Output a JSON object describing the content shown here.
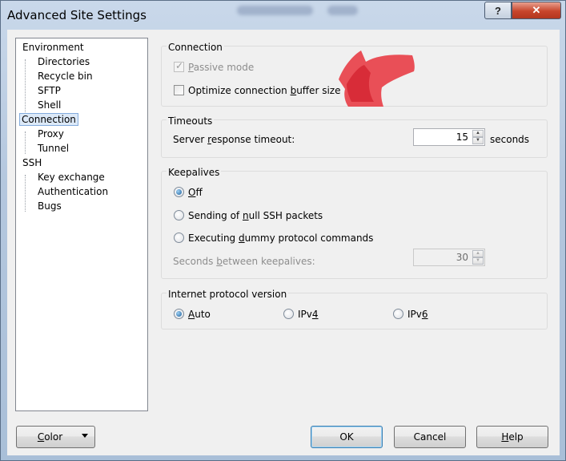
{
  "window": {
    "title": "Advanced Site Settings"
  },
  "tree": {
    "items": [
      {
        "label": "Environment",
        "level": 0
      },
      {
        "label": "Directories",
        "level": 1
      },
      {
        "label": "Recycle bin",
        "level": 1
      },
      {
        "label": "SFTP",
        "level": 1
      },
      {
        "label": "Shell",
        "level": 1
      },
      {
        "label": "Connection",
        "level": 0,
        "selected": true
      },
      {
        "label": "Proxy",
        "level": 1
      },
      {
        "label": "Tunnel",
        "level": 1
      },
      {
        "label": "SSH",
        "level": 0
      },
      {
        "label": "Key exchange",
        "level": 1
      },
      {
        "label": "Authentication",
        "level": 1
      },
      {
        "label": "Bugs",
        "level": 1
      }
    ]
  },
  "connection": {
    "title": "Connection",
    "passive_mode": {
      "label_pre": "",
      "label_u": "P",
      "label_post": "assive mode",
      "checked": true,
      "enabled": false
    },
    "optimize_buffer": {
      "label_pre": "Optimize connection ",
      "label_u": "b",
      "label_post": "uffer size",
      "checked": false
    }
  },
  "timeouts": {
    "title": "Timeouts",
    "label_pre": "Server ",
    "label_u": "r",
    "label_post": "esponse timeout:",
    "value": "15",
    "unit": "seconds"
  },
  "keepalives": {
    "title": "Keepalives",
    "off": {
      "label_pre": "",
      "label_u": "O",
      "label_post": "ff",
      "selected": true
    },
    "null_packets": {
      "label_pre": "Sending of ",
      "label_u": "n",
      "label_post": "ull SSH packets",
      "selected": false
    },
    "dummy_commands": {
      "label_pre": "Executing ",
      "label_u": "d",
      "label_post": "ummy protocol commands",
      "selected": false
    },
    "seconds_label_pre": "Seconds ",
    "seconds_label_u": "b",
    "seconds_label_post": "etween keepalives:",
    "seconds_value": "30"
  },
  "ip_version": {
    "title": "Internet protocol version",
    "auto": {
      "label_pre": "",
      "label_u": "A",
      "label_post": "uto",
      "selected": true
    },
    "ipv4": {
      "label_pre": "IPv",
      "label_u": "4",
      "label_post": "",
      "selected": false
    },
    "ipv6": {
      "label_pre": "IPv",
      "label_u": "6",
      "label_post": "",
      "selected": false
    }
  },
  "buttons": {
    "color_pre": "",
    "color_u": "C",
    "color_post": "olor",
    "ok": "OK",
    "cancel": "Cancel",
    "help_pre": "",
    "help_u": "H",
    "help_post": "elp"
  },
  "titlebar_buttons": {
    "help": "?",
    "close": "✕"
  },
  "colors": {
    "annotation": "#e8333c",
    "selected_bg": "#dce9f8",
    "close": "#c7452c"
  }
}
